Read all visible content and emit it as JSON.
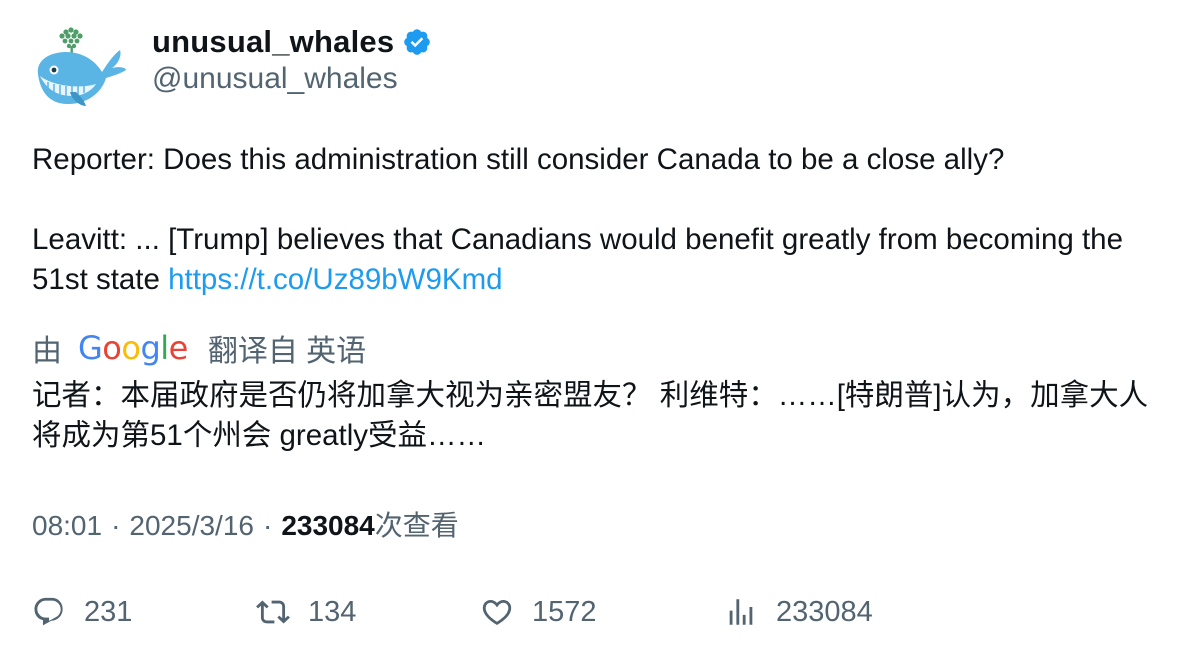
{
  "author": {
    "display_name": "unusual_whales",
    "handle": "@unusual_whales",
    "verified": true,
    "avatar_icon": "whale-avatar-icon",
    "verified_color": "#1d9bf0"
  },
  "tweet": {
    "line1": "Reporter: Does this administration still consider Canada to be a close ally?",
    "line2": "Leavitt: ... [Trump] believes that Canadians would benefit greatly from becoming the 51st state",
    "link": "https://t.co/Uz89bW9Kmd",
    "link_color": "#1d9bf0"
  },
  "translation": {
    "by_label": "由",
    "provider": "Google",
    "from_label": "翻译自 英语",
    "text": "记者：本届政府是否仍将加拿大视为亲密盟友？ 利维特：……[特朗普]认为，加拿大人将成为第51个州会 greatly受益……"
  },
  "meta": {
    "time": "08:01",
    "separator": "·",
    "date": "2025/3/16",
    "views_count": "233084",
    "views_label": "次查看"
  },
  "actions": {
    "replies": "231",
    "retweets": "134",
    "likes": "1572",
    "views": "233084",
    "icon_color": "#536471"
  }
}
